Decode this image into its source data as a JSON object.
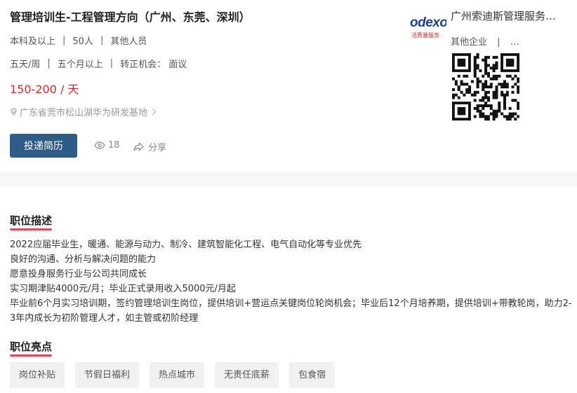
{
  "job": {
    "title": "管理培训生-工程管理方向（广州、东莞、深圳）",
    "education": "本科及以上",
    "headcount": "50人",
    "category": "其他人员",
    "days_per_week": "五天/周",
    "duration": "五个月以上",
    "conversion_label": "转正机会：",
    "conversion_value": "面议",
    "salary": "150-200 / 天",
    "address": "广东省莞市松山湖华为研发基地",
    "apply_label": "投递简历",
    "view_count": "18",
    "share_label": "分享",
    "separator": "|"
  },
  "company": {
    "logo_word": "odexo",
    "logo_sub": "活质量服务",
    "name": "广州索迪斯管理服务…",
    "type": "其他企业",
    "extra": "…"
  },
  "description": {
    "title": "职位描述",
    "lines": [
      "2022应届毕业生，暖通、能源与动力、制冷、建筑智能化工程、电气自动化等专业优先",
      "良好的沟通、分析与解决问题的能力",
      "愿意投身服务行业与公司共同成长",
      "实习期津贴4000元/月；毕业正式录用收入5000元/月起",
      "毕业前6个月实习培训期，签约管理培训生岗位，提供培训+营运点关键岗位轮岗机会；毕业后12个月培养期，提供培训+带教轮岗，助力2-3年内成长为初阶管理人才，如主管或初阶经理"
    ]
  },
  "highlights": {
    "title": "职位亮点",
    "tags": [
      "岗位补贴",
      "节假日福利",
      "热点城市",
      "无责任底薪",
      "包食宿"
    ]
  },
  "colors": {
    "accent_button": "#2f5c85",
    "salary": "#d02b2b",
    "section_underline": "#e8454f"
  },
  "icons": [
    "location-icon",
    "chevron-right-icon",
    "eye-icon",
    "share-icon",
    "qr-code-icon"
  ]
}
